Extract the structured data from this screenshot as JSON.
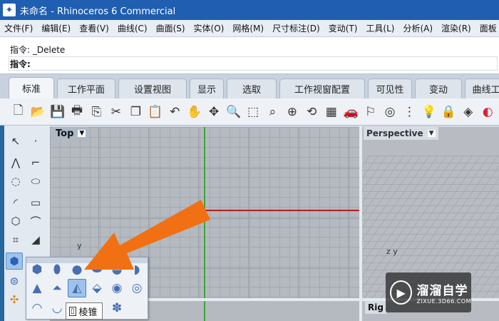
{
  "window": {
    "title": "未命名 - Rhinoceros 6 Commercial",
    "logo_icon": "rhino-logo-icon"
  },
  "menu": [
    "文件(F)",
    "编辑(E)",
    "查看(V)",
    "曲线(C)",
    "曲面(S)",
    "实体(O)",
    "网格(M)",
    "尺寸标注(D)",
    "变动(T)",
    "工具(L)",
    "分析(A)",
    "渲染(R)",
    "面板"
  ],
  "command": {
    "history": "指令: _Delete",
    "prompt": "指令:"
  },
  "tabs": [
    {
      "label": "标准",
      "active": true
    },
    {
      "label": "工作平面",
      "active": false
    },
    {
      "label": "设置视图",
      "active": false
    },
    {
      "label": "显示",
      "active": false
    },
    {
      "label": "选取",
      "active": false
    },
    {
      "label": "工作视窗配置",
      "active": false
    },
    {
      "label": "可见性",
      "active": false
    },
    {
      "label": "变动",
      "active": false
    },
    {
      "label": "曲线工",
      "active": false
    }
  ],
  "viewports": {
    "top": "Top",
    "perspective": "Perspective",
    "right": "Rig"
  },
  "axes": {
    "top": "y",
    "persp_z": "z",
    "persp_y": "y"
  },
  "flyout_tooltip": "棱锥",
  "watermark": {
    "name": "溜溜自学",
    "url": "ZIXUE.3D66.COM"
  },
  "colors": {
    "title_bar": "#1f5eb1",
    "arrow": "#f07013",
    "x_axis": "#b02020",
    "y_axis": "#3ea33b"
  }
}
